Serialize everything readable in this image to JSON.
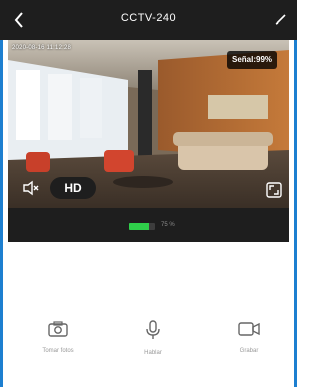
{
  "header": {
    "title": "CCTV-240",
    "back_icon": "chevron-left-icon",
    "edit_icon": "pencil-icon"
  },
  "video": {
    "timestamp": "2020-08-16 11:12:28",
    "signal_label": "Señal:99%",
    "quality_label": "HD",
    "mute_icon": "speaker-muted-icon",
    "fullscreen_icon": "fullscreen-icon"
  },
  "status": {
    "battery_text": "75 %",
    "battery_level": 0.75,
    "battery_color": "#2fcf4a"
  },
  "actions": [
    {
      "label": "Tomar fotos",
      "icon": "camera-icon"
    },
    {
      "label": "Hablar",
      "icon": "microphone-icon"
    },
    {
      "label": "Grabar",
      "icon": "video-camera-icon"
    }
  ],
  "colors": {
    "accent": "#1d7fd0",
    "dark_bar": "#1e1e1e"
  }
}
